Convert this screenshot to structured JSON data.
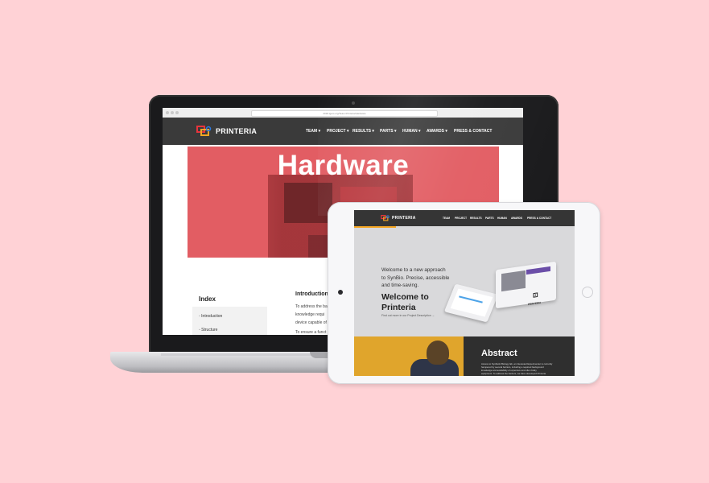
{
  "brand": {
    "name": "PRINTERIA",
    "accent_red": "#e8343c",
    "accent_orange": "#f5a623",
    "accent_blue": "#2b7be4"
  },
  "laptop": {
    "browser": {
      "url": "2018.igem.org/Team:Printeria/Hardware"
    },
    "nav": {
      "items": [
        "TEAM",
        "PROJECT",
        "RESULTS",
        "PARTS",
        "HUMAN",
        "AWARDS",
        "PRESS & CONTACT"
      ],
      "dropdown_marker": "▾"
    },
    "hero": {
      "title": "Hardware"
    },
    "index": {
      "title": "Index",
      "items": [
        "Introduction",
        "Structure"
      ]
    },
    "intro": {
      "title": "Introduction",
      "lines": [
        "To address the ba",
        "knowledge requi",
        "device capable of",
        "To ensure a funct"
      ]
    }
  },
  "tablet": {
    "nav": {
      "items": [
        "TEAM",
        "PROJECT",
        "RESULTS",
        "PARTS",
        "HUMAN",
        "AWARDS",
        "PRESS & CONTACT"
      ]
    },
    "hero": {
      "tagline": [
        "Welcome to a new approach",
        "to SynBio. Precise, accessible",
        "and time-saving."
      ],
      "welcome": [
        "Welcome to",
        "Printeria"
      ],
      "link": "Find out more in our Project Description  →",
      "product_badge": "PRINTERIA"
    },
    "abstract": {
      "title": "Abstract",
      "lines": [
        "Access to Synthetic Biology lab, an interested Experimenter is currently",
        "hampered by several barriers, including a required background",
        "knowledge and availability of expensive and often bulky",
        "equipment. To address the barriers, we have developed Printeria"
      ]
    }
  }
}
